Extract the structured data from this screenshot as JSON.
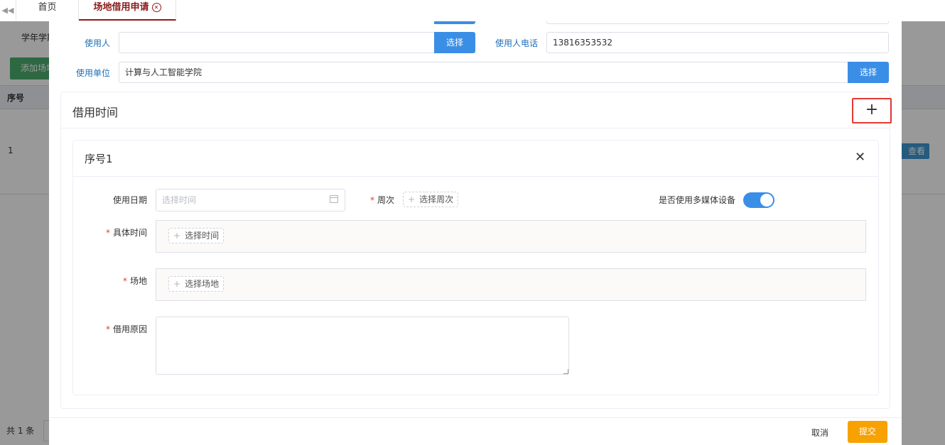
{
  "tabs": {
    "home": "首页",
    "active": "场地借用申请"
  },
  "background": {
    "filter_label": "学年学期",
    "add_button": "添加场地",
    "col_no": "序号",
    "row_no": "1",
    "view_button": "查看",
    "footer_total": "共 1 条"
  },
  "form": {
    "user_label": "使用人",
    "user_value": "",
    "user_select": "选择",
    "phone_label": "使用人电话",
    "phone_value": "13816353532",
    "unit_label": "使用单位",
    "unit_value": "计算与人工智能学院",
    "unit_select": "选择",
    "top_select": "选择"
  },
  "borrow_time": {
    "title": "借用时间",
    "add_icon": "plus-icon",
    "card": {
      "title": "序号1",
      "date_label": "使用日期",
      "date_placeholder": "选择时间",
      "week_label": "周次",
      "week_button": "选择周次",
      "multimedia_label": "是否使用多媒体设备",
      "multimedia_on": true,
      "time_label": "具体时间",
      "time_button": "选择时间",
      "venue_label": "场地",
      "venue_button": "选择场地",
      "reason_label": "借用原因",
      "reason_value": ""
    }
  },
  "footer": {
    "cancel": "取消",
    "submit": "提交"
  },
  "colors": {
    "primary": "#3a8ee6",
    "submit": "#f7a200",
    "highlight": "#e53935",
    "tab_active": "#8b1a1a"
  }
}
